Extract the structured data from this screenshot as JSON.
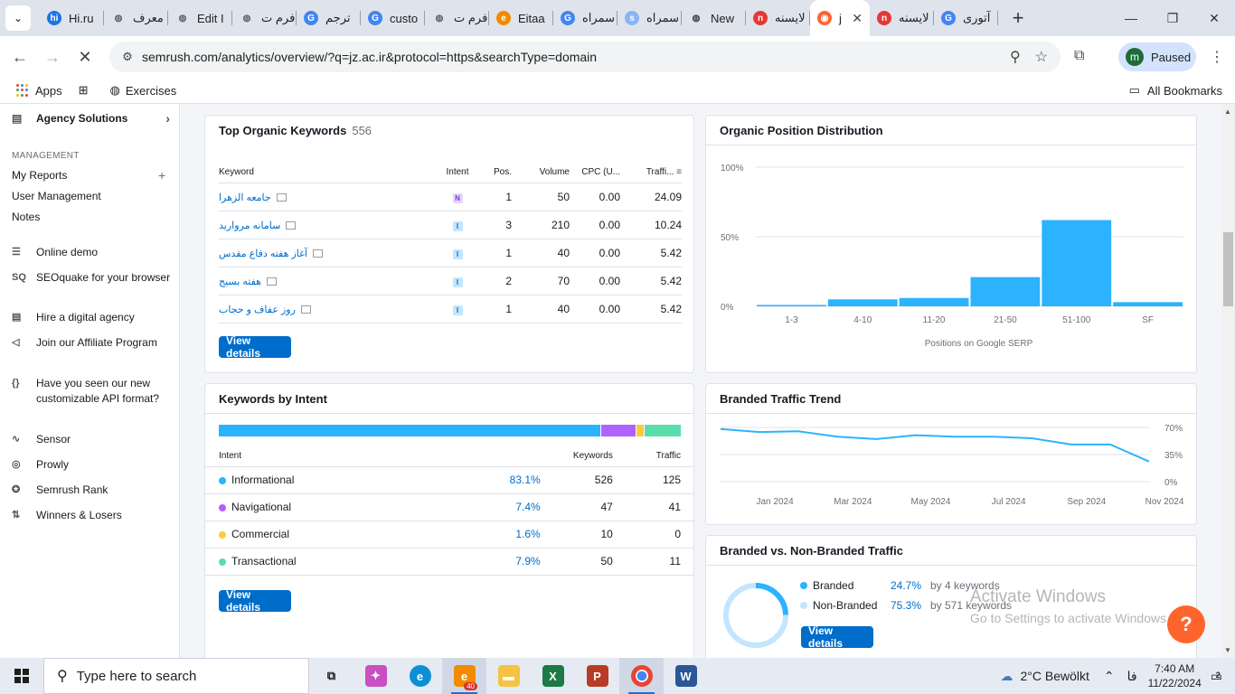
{
  "browser": {
    "tabs": [
      {
        "title": "Hi.ru",
        "fav": "hi",
        "color": "#1a73e8"
      },
      {
        "title": "معرف",
        "fav": "globe",
        "color": "#5f6368"
      },
      {
        "title": "Edit I",
        "fav": "globe",
        "color": "#5f6368"
      },
      {
        "title": "فرم ت",
        "fav": "globe",
        "color": "#5f6368"
      },
      {
        "title": "ترجم",
        "fav": "translate",
        "color": "#4285f4"
      },
      {
        "title": "custo",
        "fav": "G",
        "color": "#4285f4"
      },
      {
        "title": "فرم ت",
        "fav": "globe",
        "color": "#5f6368"
      },
      {
        "title": "Eitaa",
        "fav": "e",
        "color": "#f28b00"
      },
      {
        "title": "سمراه",
        "fav": "G",
        "color": "#4285f4"
      },
      {
        "title": "سمراه",
        "fav": "s",
        "color": "#8ab4f8"
      },
      {
        "title": "New",
        "fav": "globe",
        "color": "#3c4043"
      },
      {
        "title": "لایسنه",
        "fav": "n",
        "color": "#e53935"
      },
      {
        "title": "j",
        "fav": "semrush",
        "color": "#ff642d",
        "active": true
      },
      {
        "title": "لایسنه",
        "fav": "n",
        "color": "#e53935"
      },
      {
        "title": "آتوری",
        "fav": "G",
        "color": "#4285f4"
      }
    ],
    "url": "semrush.com/analytics/overview/?q=jz.ac.ir&protocol=https&searchType=domain",
    "profile_label": "Paused",
    "profile_initial": "m",
    "bookmarks": {
      "apps": "Apps",
      "exercises": "Exercises",
      "all": "All Bookmarks"
    }
  },
  "sidebar": {
    "agency": "Agency Solutions",
    "management_heading": "MANAGEMENT",
    "my_reports": "My Reports",
    "user_management": "User Management",
    "notes": "Notes",
    "items": [
      {
        "icon": "☰",
        "label": "Online demo"
      },
      {
        "icon": "SQ",
        "label": "SEOquake for your browser"
      },
      {
        "icon": "▤",
        "label": "Hire a digital agency"
      },
      {
        "icon": "◁",
        "label": "Join our Affiliate Program"
      },
      {
        "icon": "{}",
        "label": "Have you seen our new customizable API format?"
      },
      {
        "icon": "∿",
        "label": "Sensor"
      },
      {
        "icon": "◎",
        "label": "Prowly"
      },
      {
        "icon": "✪",
        "label": "Semrush Rank"
      },
      {
        "icon": "⇅",
        "label": "Winners & Losers"
      }
    ]
  },
  "top_keywords": {
    "title": "Top Organic Keywords",
    "count": "556",
    "headers": {
      "keyword": "Keyword",
      "intent": "Intent",
      "pos": "Pos.",
      "volume": "Volume",
      "cpc": "CPC (U...",
      "traffic": "Traffi..."
    },
    "rows": [
      {
        "keyword": "جامعه الزهرا",
        "intent": "N",
        "pos": "1",
        "volume": "50",
        "cpc": "0.00",
        "traffic": "24.09"
      },
      {
        "keyword": "سامانه مروارید",
        "intent": "I",
        "pos": "3",
        "volume": "210",
        "cpc": "0.00",
        "traffic": "10.24"
      },
      {
        "keyword": "آغاز هفته دفاع مقدس",
        "intent": "I",
        "pos": "1",
        "volume": "40",
        "cpc": "0.00",
        "traffic": "5.42"
      },
      {
        "keyword": "هفته بسیج",
        "intent": "I",
        "pos": "2",
        "volume": "70",
        "cpc": "0.00",
        "traffic": "5.42"
      },
      {
        "keyword": "روز عفاف و حجاب",
        "intent": "I",
        "pos": "1",
        "volume": "40",
        "cpc": "0.00",
        "traffic": "5.42"
      }
    ],
    "button": "View details"
  },
  "position_distribution": {
    "title": "Organic Position Distribution",
    "xlabel": "Positions on Google SERP",
    "chart_data": {
      "type": "bar",
      "categories": [
        "1-3",
        "4-10",
        "11-20",
        "21-50",
        "51-100",
        "SF"
      ],
      "values": [
        1,
        5,
        6,
        21,
        62,
        3
      ],
      "ylim": [
        0,
        100
      ],
      "yticks": [
        "100%",
        "50%",
        "0%"
      ],
      "color": "#2bb3ff"
    }
  },
  "intent": {
    "title": "Keywords by Intent",
    "headers": {
      "intent": "Intent",
      "keywords": "Keywords",
      "traffic": "Traffic"
    },
    "rows": [
      {
        "name": "Informational",
        "pct": "83.1%",
        "keywords": "526",
        "traffic": "125",
        "color": "#2bb3ff",
        "share": 83.1
      },
      {
        "name": "Navigational",
        "pct": "7.4%",
        "keywords": "47",
        "traffic": "41",
        "color": "#b061ff",
        "share": 7.4
      },
      {
        "name": "Commercial",
        "pct": "1.6%",
        "keywords": "10",
        "traffic": "0",
        "color": "#ffca39",
        "share": 1.6
      },
      {
        "name": "Transactional",
        "pct": "7.9%",
        "keywords": "50",
        "traffic": "11",
        "color": "#59ddaa",
        "share": 7.9
      }
    ],
    "button": "View details"
  },
  "branded_trend": {
    "title": "Branded Traffic Trend",
    "chart_data": {
      "type": "line",
      "x": [
        "Dec 2023",
        "Jan 2024",
        "Feb 2024",
        "Mar 2024",
        "Apr 2024",
        "May 2024",
        "Jun 2024",
        "Jul 2024",
        "Aug 2024",
        "Sep 2024",
        "Oct 2024",
        "Nov 2024"
      ],
      "xticks": [
        "Jan 2024",
        "Mar 2024",
        "May 2024",
        "Jul 2024",
        "Sep 2024",
        "Nov 2024"
      ],
      "values": [
        68,
        64,
        65,
        58,
        55,
        60,
        58,
        58,
        56,
        48,
        48,
        26
      ],
      "ylim": [
        0,
        70
      ],
      "yticks": [
        "70%",
        "35%",
        "0%"
      ],
      "color": "#2bb3ff"
    }
  },
  "branded_vs": {
    "title": "Branded vs. Non-Branded Traffic",
    "chart_data": {
      "type": "pie",
      "labels": [
        "Branded",
        "Non-Branded"
      ],
      "values": [
        24.7,
        75.3
      ],
      "colors": [
        "#2bb3ff",
        "#c4e5fe"
      ]
    },
    "rows": [
      {
        "name": "Branded",
        "pct": "24.7%",
        "kw": "by 4 keywords",
        "color": "#2bb3ff"
      },
      {
        "name": "Non-Branded",
        "pct": "75.3%",
        "kw": "by 571 keywords",
        "color": "#c4e5fe"
      }
    ],
    "button": "View details"
  },
  "watermark": {
    "line1": "Activate Windows",
    "line2": "Go to Settings to activate Windows."
  },
  "taskbar": {
    "search_placeholder": "Type here to search",
    "weather": "2°C  Bewölkt",
    "lang": "فا",
    "time": "7:40 AM",
    "date": "11/22/2024",
    "notifications": "2",
    "eitaa_badge": "40"
  }
}
